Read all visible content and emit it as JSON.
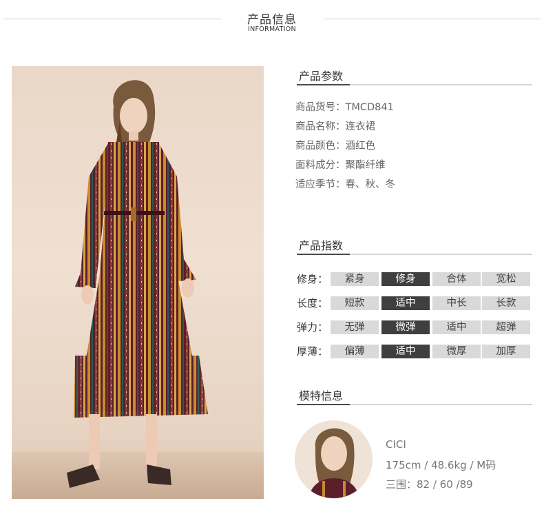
{
  "header": {
    "title": "产品信息",
    "subtitle": "INFORMATION"
  },
  "params": {
    "title": "产品参数",
    "rows": [
      {
        "label": "商品货号：",
        "value": "TMCD841"
      },
      {
        "label": "商品名称：",
        "value": "连衣裙"
      },
      {
        "label": "商品颜色：",
        "value": "酒红色"
      },
      {
        "label": "面料成分：",
        "value": "聚酯纤维"
      },
      {
        "label": "适应季节：",
        "value": "春、秋、冬"
      }
    ]
  },
  "index": {
    "title": "产品指数",
    "rows": [
      {
        "label": "修身：",
        "options": [
          "紧身",
          "修身",
          "合体",
          "宽松"
        ],
        "selected": 1
      },
      {
        "label": "长度：",
        "options": [
          "短款",
          "适中",
          "中长",
          "长款"
        ],
        "selected": 1
      },
      {
        "label": "弹力：",
        "options": [
          "无弹",
          "微弹",
          "适中",
          "超弹"
        ],
        "selected": 1
      },
      {
        "label": "厚薄：",
        "options": [
          "偏薄",
          "适中",
          "微厚",
          "加厚"
        ],
        "selected": 1
      }
    ]
  },
  "model": {
    "title": "模特信息",
    "name": "CICI",
    "stats": "175cm / 48.6kg / M码",
    "measurements": "三围：82 / 60 /89"
  },
  "colors": {
    "selected_cell": "#3f3f3f",
    "unselected_cell": "#d9d9d9",
    "dress_base": "#5a1f2a",
    "dress_stripe_gold": "#c98a2e",
    "backdrop": "#ecdccd"
  }
}
